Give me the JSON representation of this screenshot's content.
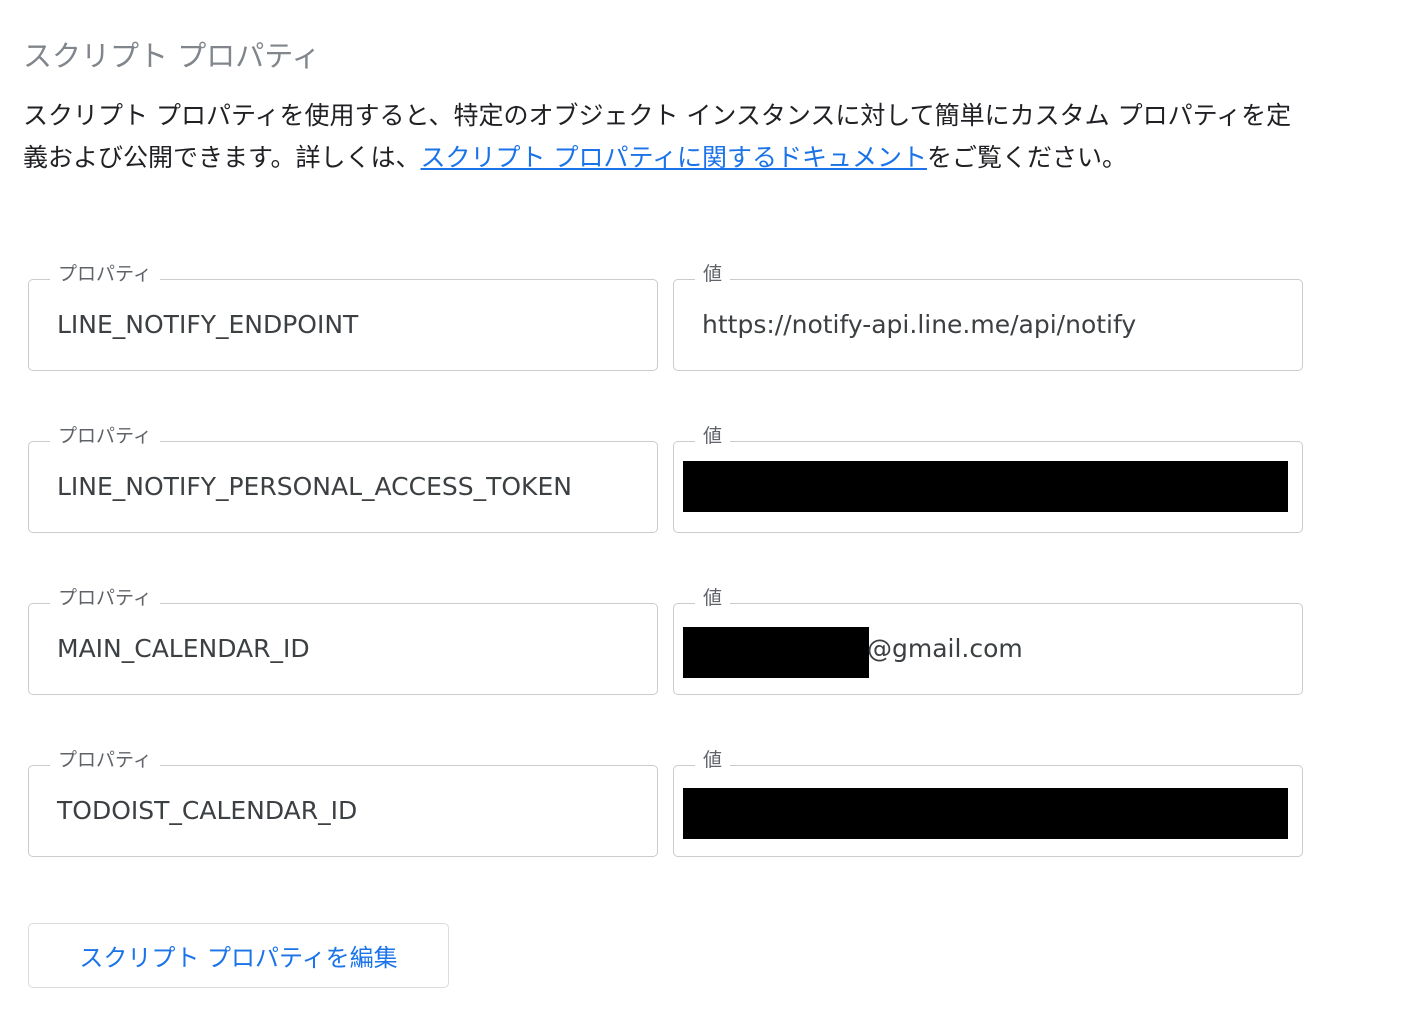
{
  "section": {
    "title": "スクリプト プロパティ",
    "description_before": "スクリプト プロパティを使用すると、特定のオブジェクト インスタンスに対して簡単にカスタム プロパティを定義および公開できます。詳しくは、",
    "description_link": "スクリプト プロパティに関するドキュメント",
    "description_after": "をご覧ください。"
  },
  "labels": {
    "property": "プロパティ",
    "value": "値"
  },
  "properties": [
    {
      "key": "LINE_NOTIFY_ENDPOINT",
      "value": "https://notify-api.line.me/api/notify"
    },
    {
      "key": "LINE_NOTIFY_PERSONAL_ACCESS_TOKEN",
      "value": ""
    },
    {
      "key": "MAIN_CALENDAR_ID",
      "value": "@gmail.com"
    },
    {
      "key": "TODOIST_CALENDAR_ID",
      "value": ""
    }
  ],
  "edit_button": {
    "label": "スクリプト プロパティを編集"
  },
  "colors": {
    "link": "#1a73e8",
    "title": "#80868b",
    "border": "#c9cbcf",
    "redaction": "#000000"
  }
}
